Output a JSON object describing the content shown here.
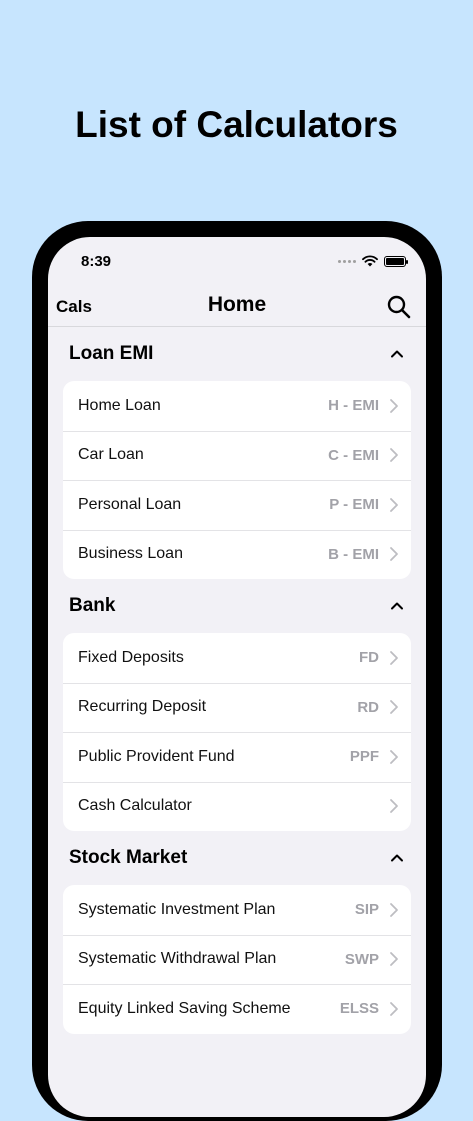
{
  "headline": "List of Calculators",
  "status_bar": {
    "time": "8:39"
  },
  "navbar": {
    "left_label": "Cals",
    "title": "Home"
  },
  "sections": [
    {
      "title": "Loan EMI",
      "items": [
        {
          "label": "Home Loan",
          "badge": "H - EMI"
        },
        {
          "label": "Car Loan",
          "badge": "C - EMI"
        },
        {
          "label": "Personal Loan",
          "badge": "P - EMI"
        },
        {
          "label": "Business Loan",
          "badge": "B - EMI"
        }
      ]
    },
    {
      "title": "Bank",
      "items": [
        {
          "label": "Fixed Deposits",
          "badge": "FD"
        },
        {
          "label": "Recurring Deposit",
          "badge": "RD"
        },
        {
          "label": "Public Provident Fund",
          "badge": "PPF"
        },
        {
          "label": "Cash Calculator",
          "badge": ""
        }
      ]
    },
    {
      "title": "Stock Market",
      "items": [
        {
          "label": "Systematic Investment Plan",
          "badge": "SIP"
        },
        {
          "label": "Systematic Withdrawal Plan",
          "badge": "SWP"
        },
        {
          "label": "Equity Linked Saving Scheme",
          "badge": "ELSS"
        }
      ]
    }
  ]
}
